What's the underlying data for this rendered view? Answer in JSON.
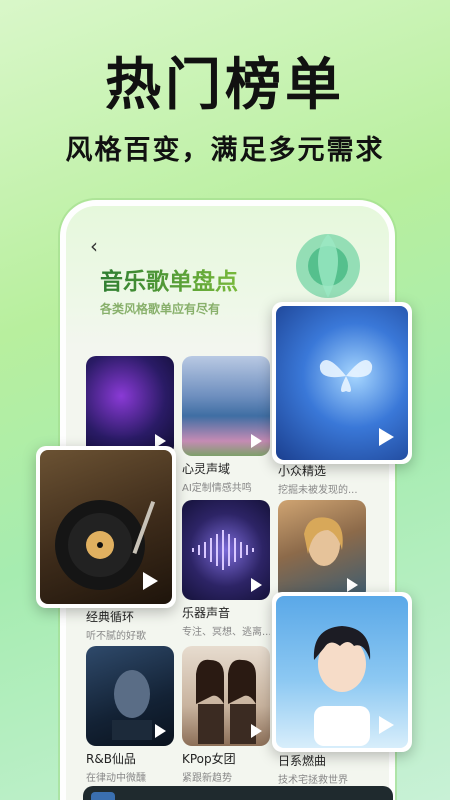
{
  "promo": {
    "title": "热门榜单",
    "subtitle": "风格百变，满足多元需求"
  },
  "page": {
    "back_icon": "‹",
    "title": "音乐歌单盘点",
    "description": "各类风格歌单应有尽有"
  },
  "playlists": [
    {
      "name": "",
      "desc": ""
    },
    {
      "name": "心灵声域",
      "desc": "AI定制情感共鸣"
    },
    {
      "name": "小众精选",
      "desc": "挖掘未被发现的..."
    },
    {
      "name": "经典循环",
      "desc": "听不腻的好歌"
    },
    {
      "name": "乐器声音",
      "desc": "专注、冥想、逃离..."
    },
    {
      "name": "",
      "desc": ""
    },
    {
      "name": "R&B仙品",
      "desc": "在律动中微醺"
    },
    {
      "name": "KPop女团",
      "desc": "紧跟新趋势"
    },
    {
      "name": "日系燃曲",
      "desc": "技术宅拯救世界"
    }
  ],
  "colors": {
    "accent": "#2e7d32",
    "background": "#b8ef9e"
  }
}
